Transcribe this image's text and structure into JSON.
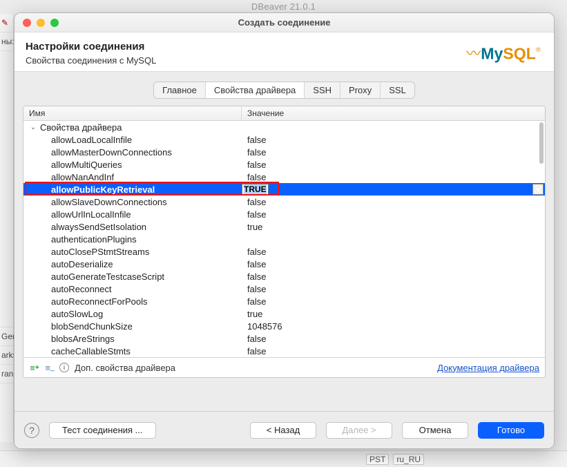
{
  "app_title": "DBeaver 21.0.1",
  "dialog_title": "Создать соединение",
  "header": {
    "title": "Настройки соединения",
    "subtitle": "Свойства соединения с MySQL"
  },
  "logo": {
    "my": "My",
    "sql": "SQL",
    "tm": "®"
  },
  "tabs": [
    {
      "label": "Главное",
      "active": false
    },
    {
      "label": "Свойства драйвера",
      "active": true
    },
    {
      "label": "SSH",
      "active": false
    },
    {
      "label": "Proxy",
      "active": false
    },
    {
      "label": "SSL",
      "active": false
    }
  ],
  "columns": {
    "name": "Имя",
    "value": "Значение"
  },
  "group_label": "Свойства драйвера",
  "properties": [
    {
      "name": "allowLoadLocalInfile",
      "value": "false"
    },
    {
      "name": "allowMasterDownConnections",
      "value": "false"
    },
    {
      "name": "allowMultiQueries",
      "value": "false"
    },
    {
      "name": "allowNanAndInf",
      "value": "false"
    },
    {
      "name": "allowPublicKeyRetrieval",
      "value": "TRUE",
      "selected": true,
      "highlight": true
    },
    {
      "name": "allowSlaveDownConnections",
      "value": "false"
    },
    {
      "name": "allowUrlInLocalInfile",
      "value": "false"
    },
    {
      "name": "alwaysSendSetIsolation",
      "value": "true"
    },
    {
      "name": "authenticationPlugins",
      "value": ""
    },
    {
      "name": "autoClosePStmtStreams",
      "value": "false"
    },
    {
      "name": "autoDeserialize",
      "value": "false"
    },
    {
      "name": "autoGenerateTestcaseScript",
      "value": "false"
    },
    {
      "name": "autoReconnect",
      "value": "false"
    },
    {
      "name": "autoReconnectForPools",
      "value": "false"
    },
    {
      "name": "autoSlowLog",
      "value": "true"
    },
    {
      "name": "blobSendChunkSize",
      "value": "1048576"
    },
    {
      "name": "blobsAreStrings",
      "value": "false"
    },
    {
      "name": "cacheCallableStmts",
      "value": "false"
    }
  ],
  "footer_toolbar": {
    "info_label": "Доп. свойства драйвера",
    "doc_link": "Документация драйвера"
  },
  "buttons": {
    "help_tooltip": "?",
    "test": "Тест соединения ...",
    "back": "< Назад",
    "next": "Далее >",
    "cancel": "Отмена",
    "finish": "Готово"
  },
  "left_panel": {
    "top": "ны:",
    "mid1": "Ger",
    "mid2": "arks",
    "mid3": "ran"
  },
  "statusbar": {
    "tz": "PST",
    "locale": "ru_RU"
  }
}
